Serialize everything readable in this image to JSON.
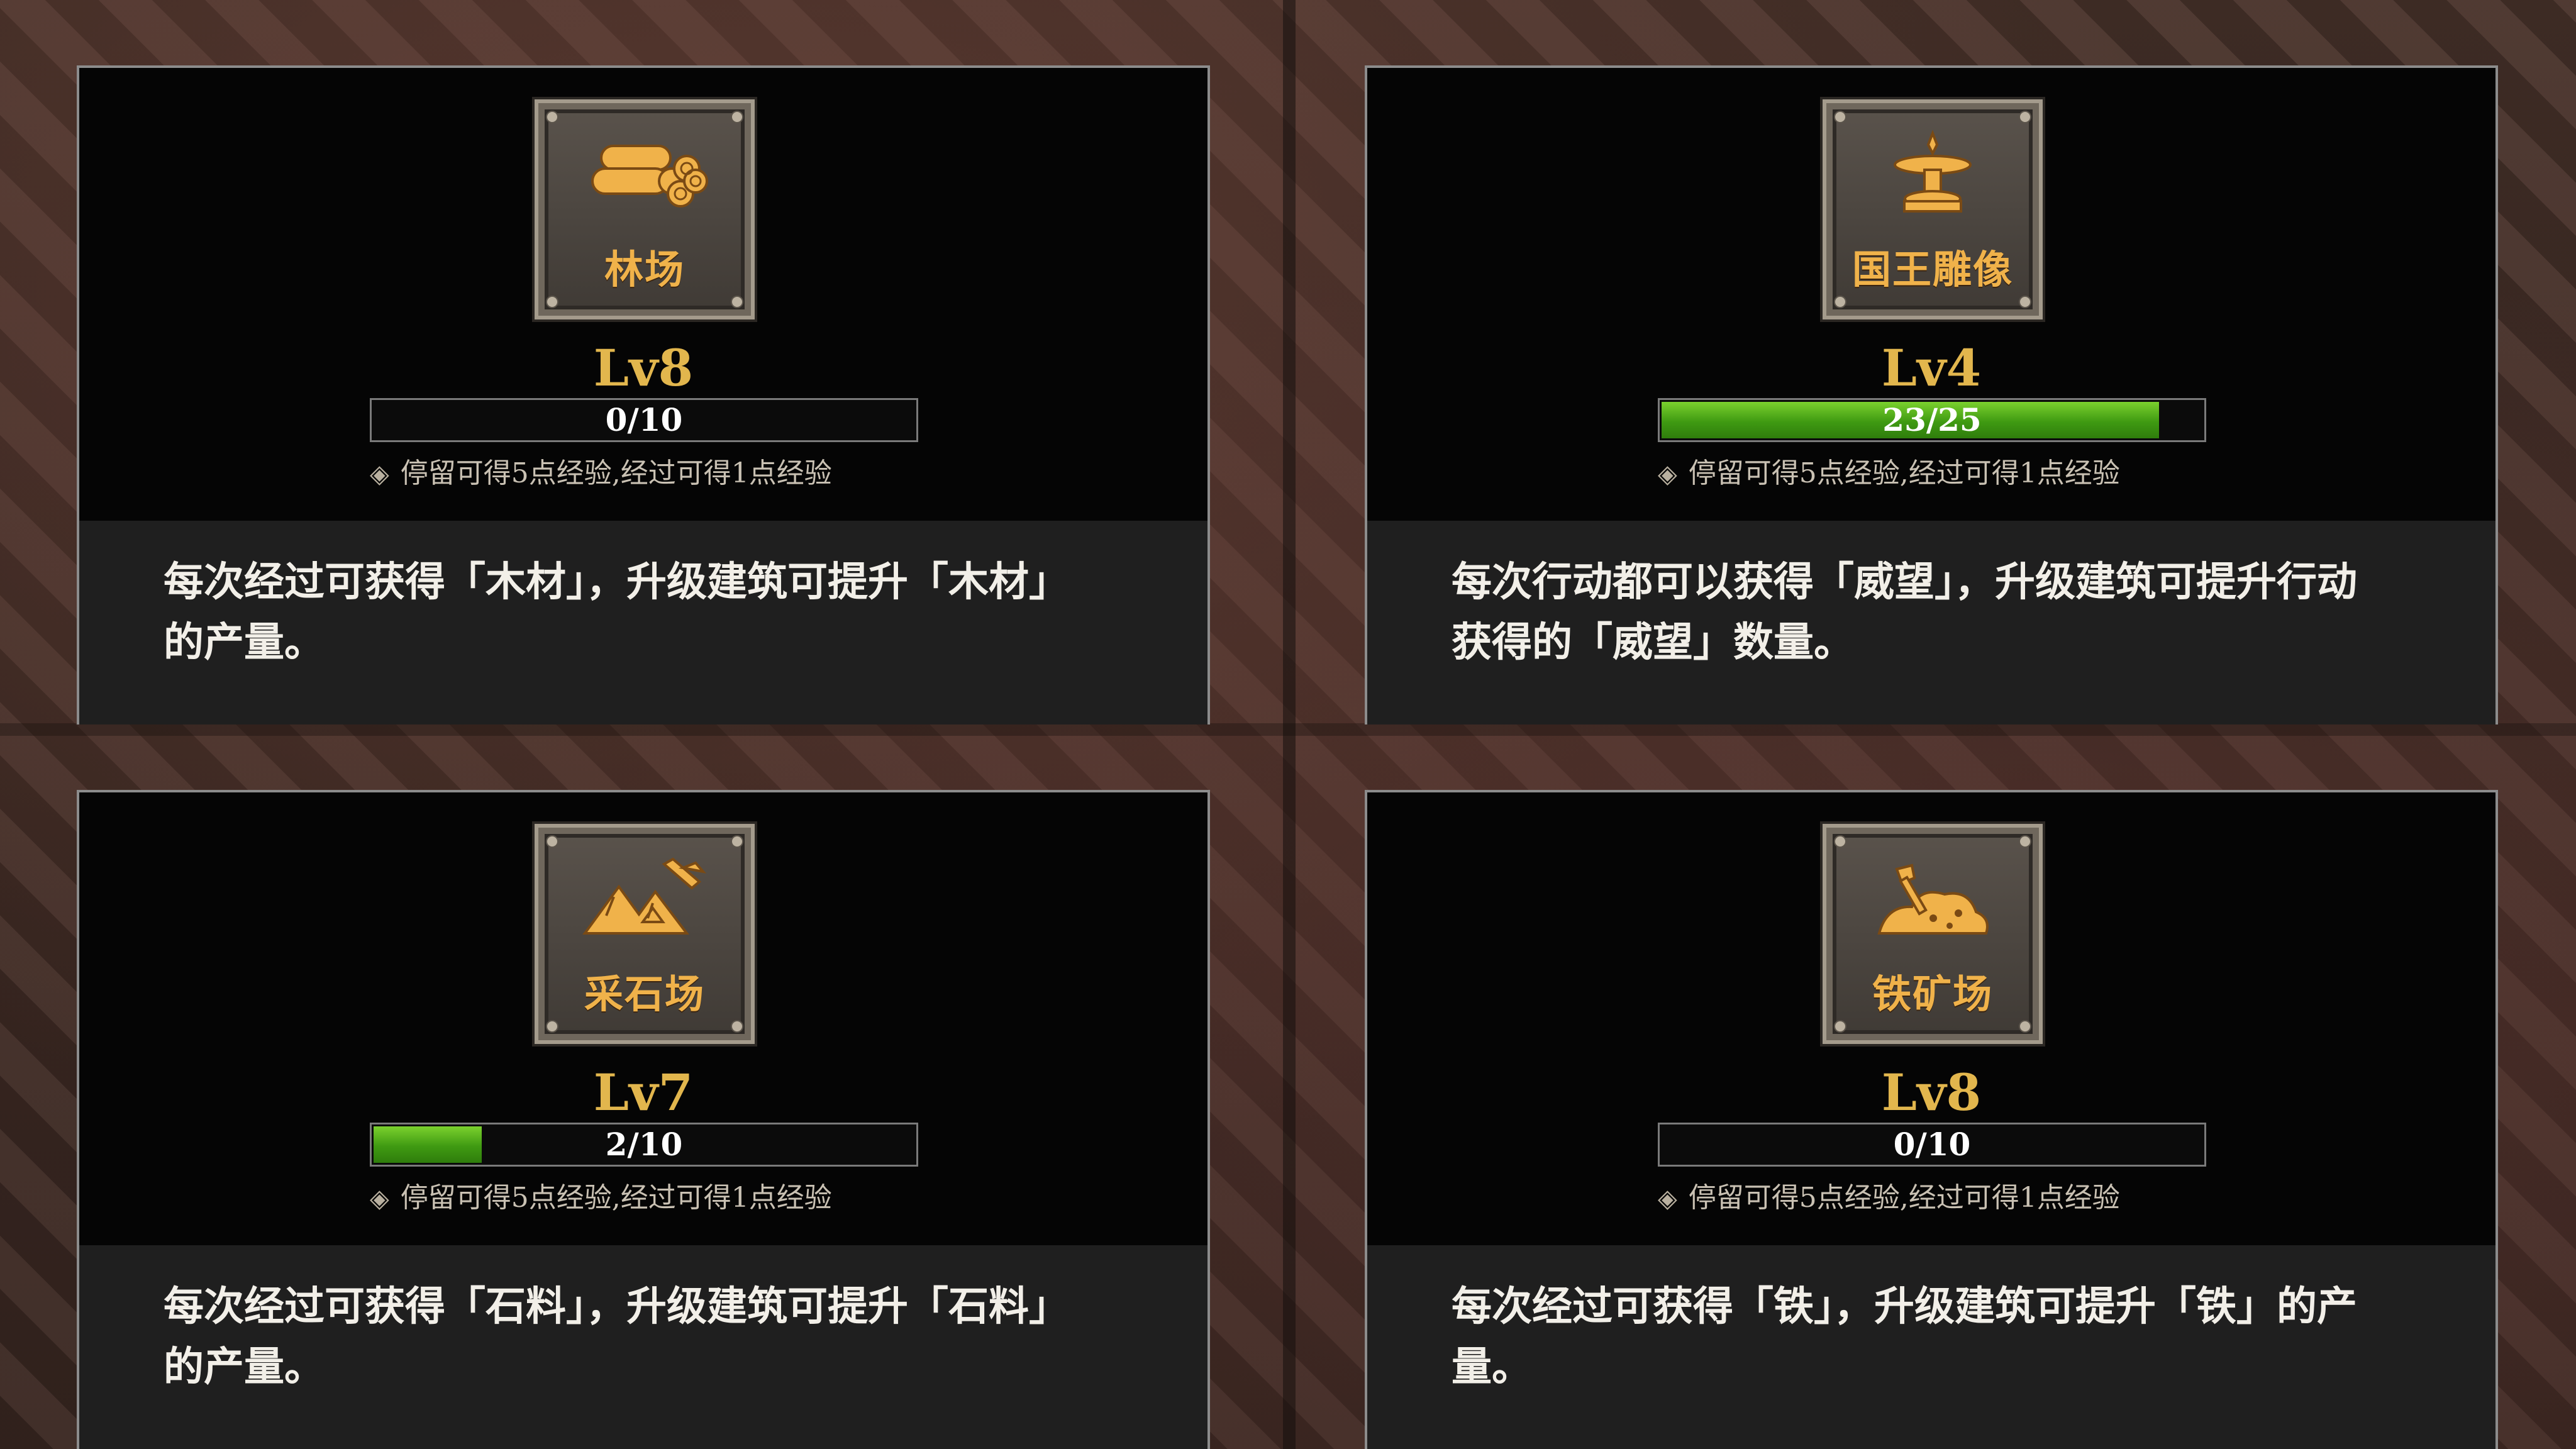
{
  "cards": [
    {
      "icon_name": "log-pile-icon",
      "icon_label": "林场",
      "level": "Lv8",
      "progress_text": "0/10",
      "progress_fraction": 0.0,
      "hint": "停留可得5点经验,经过可得1点经验",
      "desc_line1": "每次经过可获得「木材」，升级建筑可提升「木材」",
      "desc_line2": "的产量。"
    },
    {
      "icon_name": "king-statue-icon",
      "icon_label": "国王雕像",
      "level": "Lv4",
      "progress_text": "23/25",
      "progress_fraction": 0.92,
      "hint": "停留可得5点经验,经过可得1点经验",
      "desc_line1": "每次行动都可以获得「威望」，升级建筑可提升行动",
      "desc_line2": "获得的「威望」数量。"
    },
    {
      "icon_name": "quarry-rocks-icon",
      "icon_label": "采石场",
      "level": "Lv7",
      "progress_text": "2/10",
      "progress_fraction": 0.2,
      "hint": "停留可得5点经验,经过可得1点经验",
      "desc_line1": "每次经过可获得「石料」，升级建筑可提升「石料」",
      "desc_line2": "的产量。"
    },
    {
      "icon_name": "iron-ore-shovel-icon",
      "icon_label": "铁矿场",
      "level": "Lv8",
      "progress_text": "0/10",
      "progress_fraction": 0.0,
      "hint": "停留可得5点经验,经过可得1点经验",
      "desc_line1": "每次经过可获得「铁」，升级建筑可提升「铁」的产",
      "desc_line2": "量。"
    }
  ],
  "colors": {
    "icon_gold": "#f0b24a",
    "level_gold": "#e2b64d",
    "progress_green": "#5cb81e"
  }
}
